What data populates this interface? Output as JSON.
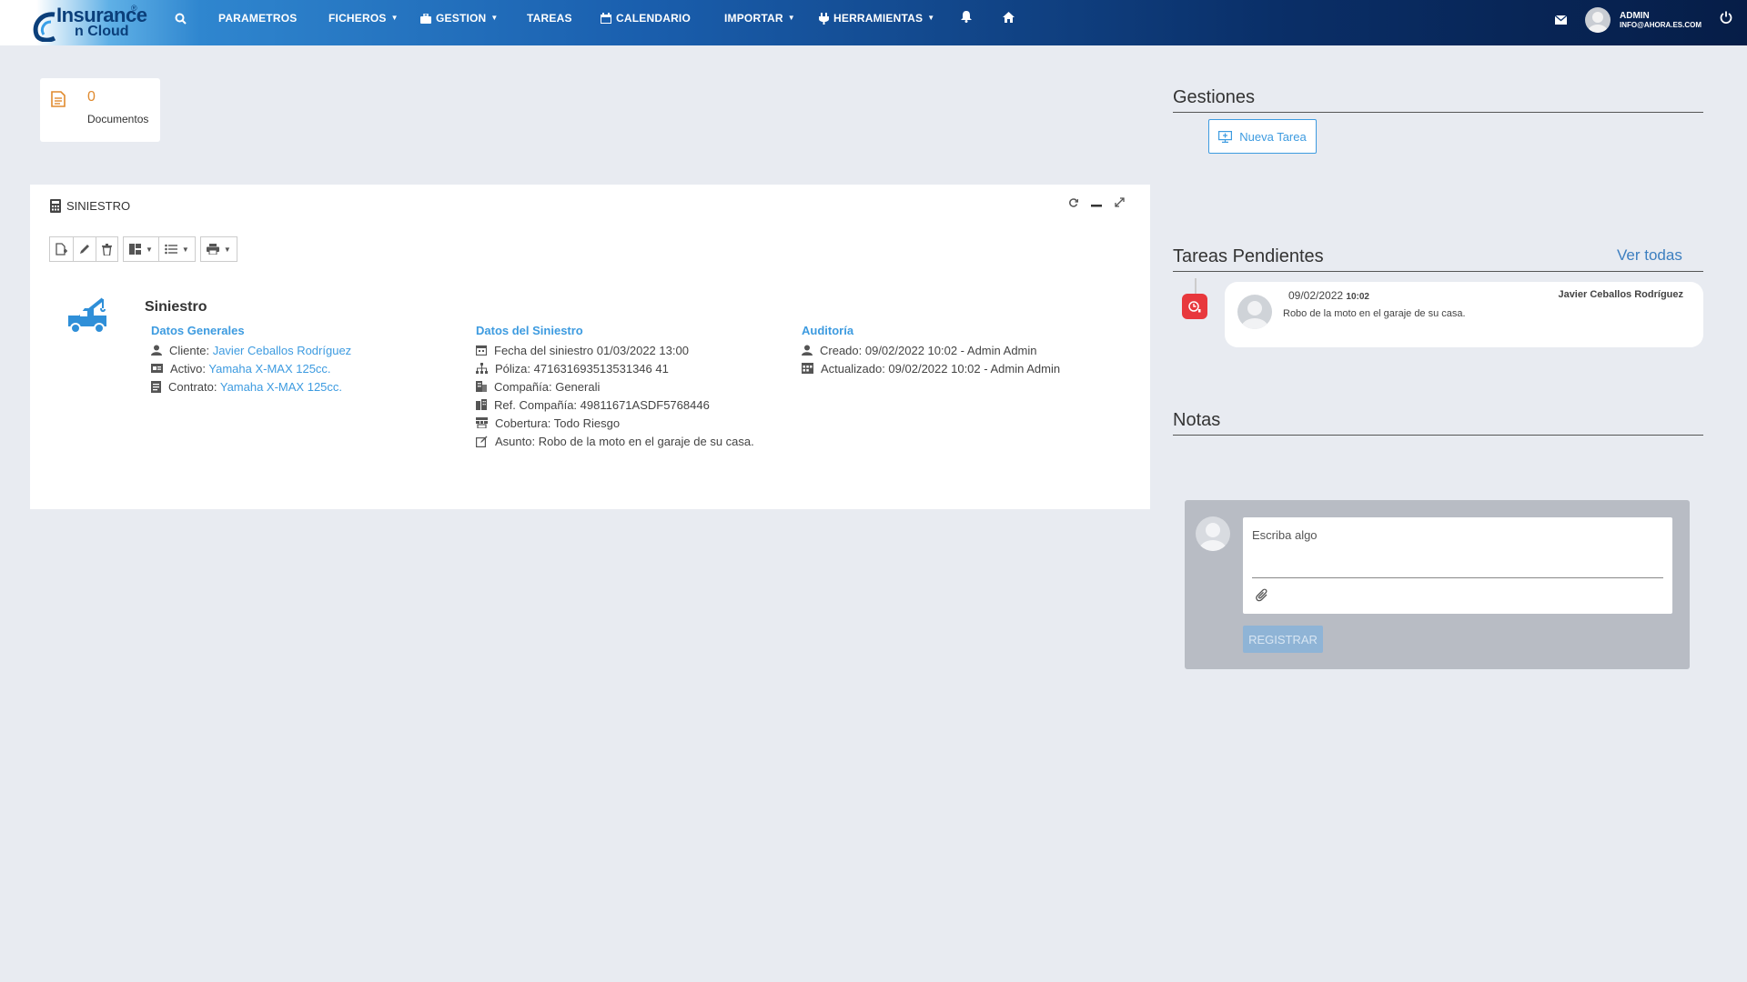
{
  "nav": {
    "logo_line1": "Insurance",
    "logo_line2": "n Cloud",
    "logo_reg": "®",
    "items": [
      {
        "label": "PARAMETROS"
      },
      {
        "label": "FICHEROS"
      },
      {
        "label": "GESTION"
      },
      {
        "label": "TAREAS"
      },
      {
        "label": "CALENDARIO"
      },
      {
        "label": "IMPORTAR"
      },
      {
        "label": "HERRAMIENTAS"
      }
    ],
    "user_name": "ADMIN",
    "user_email": "INFO@AHORA.ES.COM"
  },
  "documents": {
    "count": "0",
    "label": "Documentos"
  },
  "panel": {
    "title": "SINIESTRO",
    "section_title": "Siniestro",
    "datos_generales": {
      "heading": "Datos Generales",
      "rows": [
        {
          "key": "Cliente: ",
          "value": "Javier Ceballos Rodríguez"
        },
        {
          "key": "Activo: ",
          "value": "Yamaha X-MAX 125cc."
        },
        {
          "key": "Contrato: ",
          "value": "Yamaha X-MAX 125cc."
        }
      ]
    },
    "datos_siniestro": {
      "heading": "Datos del Siniestro",
      "rows": [
        {
          "text": "Fecha del siniestro 01/03/2022 13:00"
        },
        {
          "text": "Póliza: 471631693513531346 41"
        },
        {
          "text": "Compañía: Generali"
        },
        {
          "text": "Ref. Compañía: 49811671ASDF5768446"
        },
        {
          "text": "Cobertura: Todo Riesgo"
        },
        {
          "text": "Asunto: Robo de la moto en el garaje de su casa."
        }
      ]
    },
    "auditoria": {
      "heading": "Auditoría",
      "rows": [
        {
          "text": "Creado: 09/02/2022 10:02 - Admin Admin"
        },
        {
          "text": "Actualizado: 09/02/2022 10:02 - Admin Admin"
        }
      ]
    }
  },
  "right": {
    "gestiones": "Gestiones",
    "nueva_tarea": "Nueva Tarea",
    "tareas_pendientes": "Tareas Pendientes",
    "ver_todas": "Ver todas",
    "task": {
      "date": "09/02/2022",
      "time": "10:02",
      "who": "Javier Ceballos Rodríguez",
      "text": "Robo de la moto en el garaje de su casa."
    },
    "notas": "Notas",
    "note_placeholder": "Escriba algo",
    "registrar": "REGISTRAR"
  },
  "colors": {
    "accent": "#3d9be0",
    "orange": "#e08a2e",
    "alert": "#e8383d"
  }
}
